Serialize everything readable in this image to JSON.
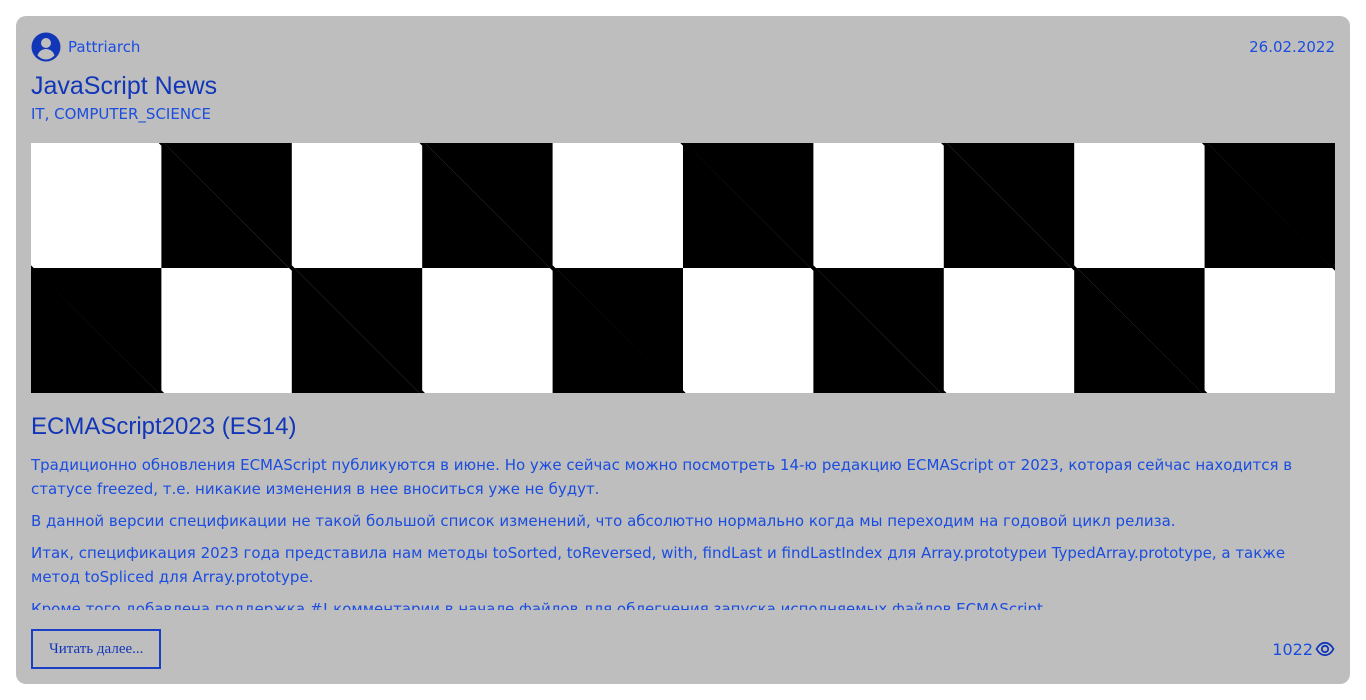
{
  "post": {
    "author": {
      "name": "Pattriarch",
      "icon": "user-circle-icon"
    },
    "date": "26.02.2022",
    "title": "JavaScript News",
    "tags": "IT, COMPUTER_SCIENCE",
    "image": {
      "icon": "checkerboard-image"
    },
    "subtitle": "ECMAScript2023 (ES14)",
    "paragraphs": [
      "Традиционно обновления ECMAScript публикуются в июне. Но уже сейчас можно посмотреть 14-ю редакцию ECMAScript от 2023, которая сейчас находится в статусе freezed, т.е. никакие изменения в нее вноситься уже не будут.",
      "В данной версии спецификации не такой большой список изменений, что абсолютно нормально когда мы переходим на годовой цикл релиза.",
      "Итак, спецификация 2023 года представила нам методы toSorted, toReversed, with, findLast и findLastIndex для Array.prototypeи TypedArray.prototype, а также метод toSpliced для Array.prototype.",
      "Кроме того добавлена поддержка #! комментарии в начале файлов для облегчения запуска исполняемых файлов ECMAScript."
    ],
    "read_more_label": "Читать далее...",
    "views": "1022",
    "views_icon": "eye-icon"
  },
  "colors": {
    "card_background": "#bebebe",
    "accent": "#1a4de0",
    "heading": "#1236b8"
  }
}
